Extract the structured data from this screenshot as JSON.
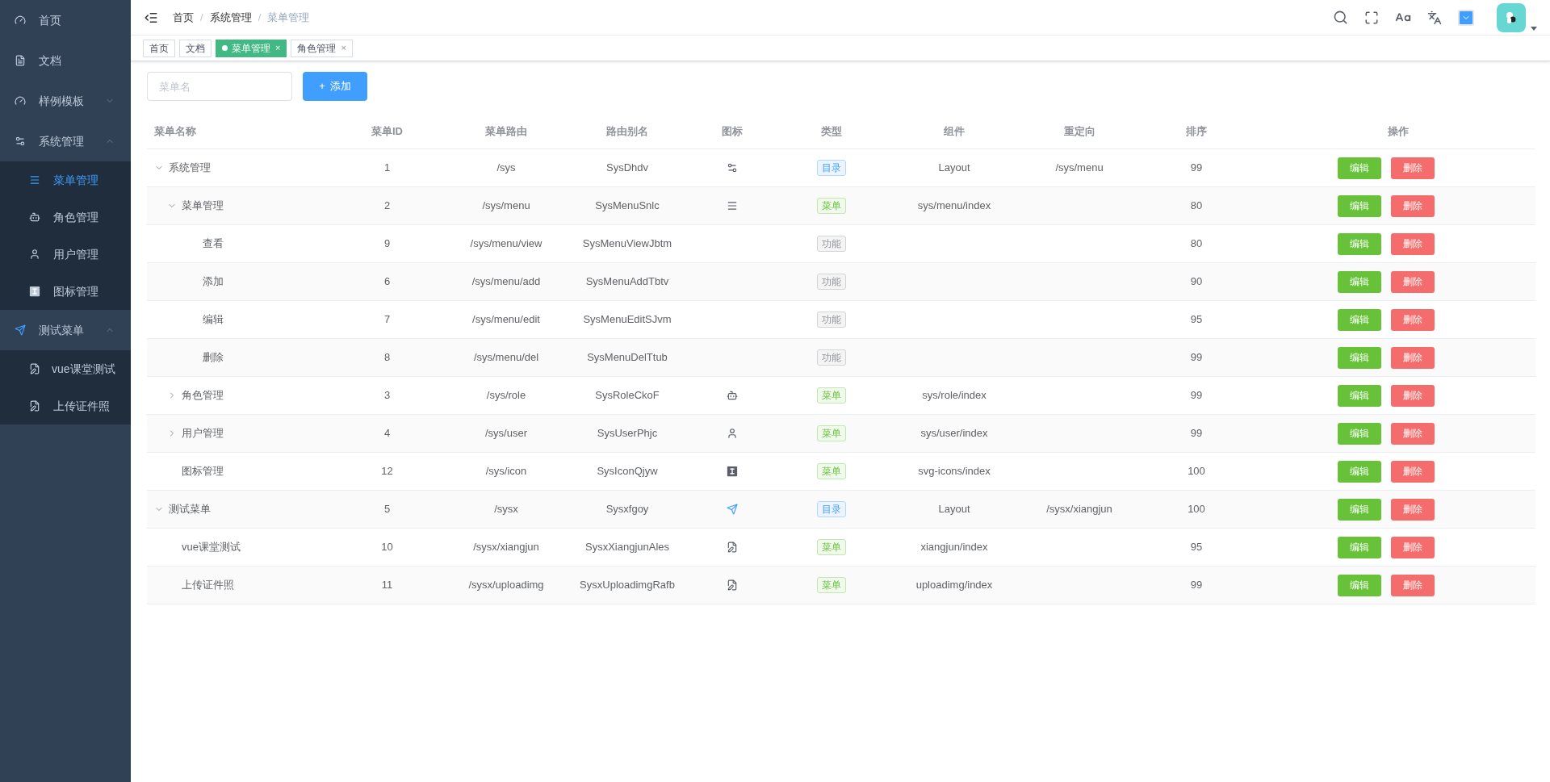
{
  "sidebar": {
    "items": [
      {
        "label": "首页",
        "selected": false
      },
      {
        "label": "文档",
        "selected": false
      },
      {
        "label": "样例模板",
        "selected": false,
        "expanded": false
      },
      {
        "label": "系统管理",
        "selected": false,
        "expanded": true,
        "children": [
          {
            "label": "菜单管理",
            "selected": true
          },
          {
            "label": "角色管理",
            "selected": false
          },
          {
            "label": "用户管理",
            "selected": false
          },
          {
            "label": "图标管理",
            "selected": false
          }
        ]
      },
      {
        "label": "测试菜单",
        "selected": false,
        "expanded": true,
        "children": [
          {
            "label": "vue课堂测试",
            "selected": false
          },
          {
            "label": "上传证件照",
            "selected": false
          }
        ]
      }
    ]
  },
  "breadcrumb": [
    {
      "label": "首页",
      "current": false
    },
    {
      "label": "系统管理",
      "current": false
    },
    {
      "label": "菜单管理",
      "current": true
    }
  ],
  "breadcrumb_separator": "/",
  "tags": [
    {
      "label": "首页",
      "selected": false,
      "closable": false
    },
    {
      "label": "文档",
      "selected": false,
      "closable": false
    },
    {
      "label": "菜单管理",
      "selected": true,
      "closable": true
    },
    {
      "label": "角色管理",
      "selected": false,
      "closable": true
    }
  ],
  "tag_close": "×",
  "search": {
    "placeholder": "菜单名"
  },
  "add_button": {
    "label": "添加",
    "icon": "+"
  },
  "table": {
    "columns": [
      "菜单名称",
      "菜单ID",
      "菜单路由",
      "路由别名",
      "图标",
      "类型",
      "组件",
      "重定向",
      "排序",
      "操作"
    ],
    "rows": [
      {
        "name": "系统管理",
        "id": "1",
        "path": "/sys",
        "alias": "SysDhdv",
        "type": "目录",
        "kind": "directory",
        "component": "Layout",
        "redirect": "/sys/menu",
        "sort": "99",
        "actions": [
          "编辑",
          "删除"
        ],
        "expanded": true,
        "children": [
          {
            "name": "菜单管理",
            "id": "2",
            "path": "/sys/menu",
            "alias": "SysMenuSnlc",
            "type": "菜单",
            "kind": "menu",
            "component": "sys/menu/index",
            "sort": "80",
            "actions": [
              "编辑",
              "删除"
            ],
            "expanded": true,
            "children": [
              {
                "name": "查看",
                "id": "9",
                "path": "/sys/menu/view",
                "alias": "SysMenuViewJbtm",
                "type": "功能",
                "kind": "function",
                "sort": "80",
                "actions": [
                  "编辑",
                  "删除"
                ]
              },
              {
                "name": "添加",
                "id": "6",
                "path": "/sys/menu/add",
                "alias": "SysMenuAddTbtv",
                "type": "功能",
                "kind": "function",
                "sort": "90",
                "actions": [
                  "编辑",
                  "删除"
                ]
              },
              {
                "name": "编辑",
                "id": "7",
                "path": "/sys/menu/edit",
                "alias": "SysMenuEditSJvm",
                "type": "功能",
                "kind": "function",
                "sort": "95",
                "actions": [
                  "编辑",
                  "删除"
                ]
              },
              {
                "name": "删除",
                "id": "8",
                "path": "/sys/menu/del",
                "alias": "SysMenuDelTtub",
                "type": "功能",
                "kind": "function",
                "sort": "99",
                "actions": [
                  "编辑",
                  "删除"
                ]
              }
            ]
          },
          {
            "name": "角色管理",
            "id": "3",
            "path": "/sys/role",
            "alias": "SysRoleCkoF",
            "type": "菜单",
            "kind": "menu",
            "component": "sys/role/index",
            "sort": "99",
            "actions": [
              "编辑",
              "删除"
            ],
            "expanded": false
          },
          {
            "name": "用户管理",
            "id": "4",
            "path": "/sys/user",
            "alias": "SysUserPhjc",
            "type": "菜单",
            "kind": "menu",
            "component": "sys/user/index",
            "sort": "99",
            "actions": [
              "编辑",
              "删除"
            ],
            "expanded": false
          },
          {
            "name": "图标管理",
            "id": "12",
            "path": "/sys/icon",
            "alias": "SysIconQjyw",
            "type": "菜单",
            "kind": "menu",
            "component": "svg-icons/index",
            "sort": "100",
            "actions": [
              "编辑",
              "删除"
            ]
          }
        ]
      },
      {
        "name": "测试菜单",
        "id": "5",
        "path": "/sysx",
        "alias": "Sysxfgoy",
        "type": "目录",
        "kind": "directory",
        "component": "Layout",
        "redirect": "/sysx/xiangjun",
        "sort": "100",
        "actions": [
          "编辑",
          "删除"
        ],
        "expanded": true,
        "children": [
          {
            "name": "vue课堂测试",
            "id": "10",
            "path": "/sysx/xiangjun",
            "alias": "SysxXiangjunAles",
            "type": "菜单",
            "kind": "menu",
            "component": "xiangjun/index",
            "sort": "95",
            "actions": [
              "编辑",
              "删除"
            ]
          },
          {
            "name": "上传证件照",
            "id": "11",
            "path": "/sysx/uploadimg",
            "alias": "SysxUploadimgRafb",
            "type": "菜单",
            "kind": "menu",
            "component": "uploadimg/index",
            "sort": "99",
            "actions": [
              "编辑",
              "删除"
            ]
          }
        ]
      }
    ]
  }
}
